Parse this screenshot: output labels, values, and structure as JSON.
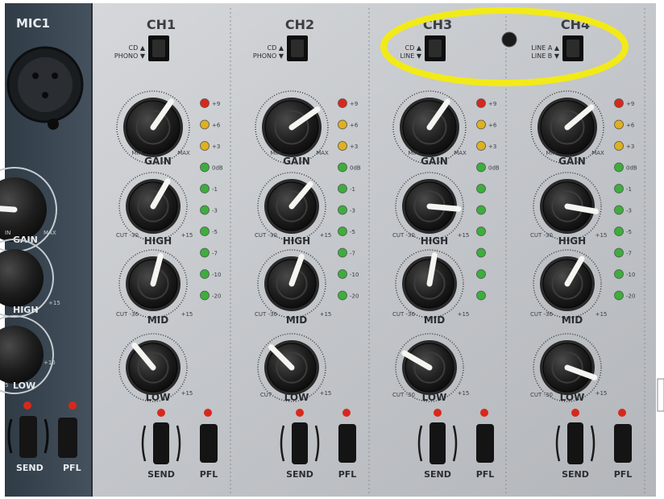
{
  "mixer": {
    "mic_strip": {
      "title": "MIC1",
      "gain_label": "GAIN",
      "gain_min": "IN",
      "gain_max": "MAX",
      "high_label": "HIGH",
      "high_plus": "+15",
      "low_label": "LOW",
      "low_plus": "+15",
      "low_minus": "5",
      "send_label": "SEND",
      "pfl_label": "PFL"
    },
    "channels": [
      {
        "title": "CH1",
        "switch_top": "CD ▲",
        "switch_bottom": "PHONO ▼",
        "gain_label": "GAIN",
        "gain_min": "MIN",
        "gain_max": "MAX",
        "high_label": "HIGH",
        "high_cut": "CUT -30",
        "high_plus": "+15",
        "mid_label": "MID",
        "mid_cut": "CUT -30",
        "mid_plus": "+15",
        "low_label": "LOW",
        "low_plus": "+15",
        "send_label": "SEND",
        "pfl_label": "PFL"
      },
      {
        "title": "CH2",
        "switch_top": "CD ▲",
        "switch_bottom": "PHONO ▼",
        "gain_label": "GAIN",
        "gain_min": "MIN",
        "gain_max": "MAX",
        "high_label": "HIGH",
        "high_cut": "CUT -30",
        "high_plus": "+15",
        "mid_label": "MID",
        "mid_cut": "CUT -30",
        "mid_plus": "+15",
        "low_label": "LOW",
        "low_cut": "CUT",
        "low_plus": "+15",
        "send_label": "SEND",
        "pfl_label": "PFL"
      },
      {
        "title": "CH3",
        "switch_top": "CD ▲",
        "switch_bottom": "LINE ▼",
        "gain_label": "GAIN",
        "gain_min": "MIN",
        "gain_max": "MAX",
        "high_label": "HIGH",
        "high_cut": "CUT -30",
        "high_plus": "+15",
        "mid_label": "MID",
        "mid_cut": "CUT -30",
        "mid_plus": "+15",
        "low_label": "LOW",
        "low_cut": "CUT -30",
        "low_plus": "+15",
        "send_label": "SEND",
        "pfl_label": "PFL"
      },
      {
        "title": "CH4",
        "switch_top": "LINE A ▲",
        "switch_bottom": "LINE B ▼",
        "gain_label": "GAIN",
        "gain_min": "MIN",
        "gain_max": "MAX",
        "high_label": "HIGH",
        "high_cut": "CUT -30",
        "high_plus": "+15",
        "mid_label": "MID",
        "mid_cut": "CUT -30",
        "mid_plus": "+15",
        "low_label": "LOW",
        "low_cut": "CUT -30",
        "low_plus": "+15",
        "send_label": "SEND",
        "pfl_label": "PFL"
      }
    ],
    "meter_labels": [
      "+9",
      "+6",
      "+3",
      "0dB",
      "-1",
      "-3",
      "-5",
      "-7",
      "-10",
      "-20"
    ],
    "meter_colors": [
      "#d8281c",
      "#e0b020",
      "#e0b020",
      "#3cae3c",
      "#3cae3c",
      "#3cae3c",
      "#3cae3c",
      "#3cae3c",
      "#3cae3c",
      "#3cae3c"
    ],
    "highlight_color": "#f2ea18",
    "panel_color": "#c9ccd0",
    "mic_panel_color": "#3d4a55"
  }
}
